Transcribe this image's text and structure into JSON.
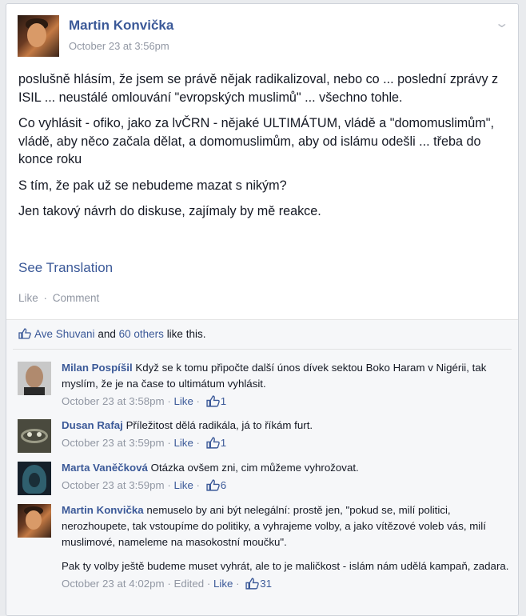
{
  "post": {
    "author": "Martin Konvička",
    "time": "October 23 at 3:56pm",
    "paragraphs": [
      "poslušně hlásím, že jsem se právě nějak radikalizoval, nebo co ... poslední zprávy z ISIL ... neustálé omlouvání \"evropských muslimů\" ... všechno tohle.",
      "Co vyhlásit - ofiko, jako za lvČRN - nějaké ULTIMÁTUM, vládě a \"domomuslimům\", vládě, aby něco začala dělat, a domomuslimům, aby od islámu odešli ... třeba do konce roku",
      "S tím, že pak už se nebudeme mazat s nikým?",
      "Jen takový návrh do diskuse, zajímaly by mě reakce."
    ],
    "see_translation": "See Translation",
    "like_label": "Like",
    "comment_label": "Comment",
    "separator": "·"
  },
  "likes": {
    "first_liker": "Ave Shuvani",
    "and_text": "and",
    "others": "60 others",
    "suffix": "like this."
  },
  "comments": [
    {
      "author": "Milan Pospíšil",
      "text": "Když se k tomu připočte další únos dívek sektou Boko Haram v Nigérii, tak myslím, že je na čase to ultimátum vyhlásit.",
      "time": "October 23 at 3:58pm",
      "like": "Like",
      "count": "1"
    },
    {
      "author": "Dusan Rafaj",
      "text": "Příležitost dělá radikála, já to říkám furt.",
      "time": "October 23 at 3:59pm",
      "like": "Like",
      "count": "1"
    },
    {
      "author": "Marta Vaněčková",
      "text": "Otázka ovšem zni, cim můžeme vyhrožovat.",
      "time": "October 23 at 3:59pm",
      "like": "Like",
      "count": "6"
    },
    {
      "author": "Martin Konvička",
      "text": "nemuselo by ani být nelegální: prostě jen, \"pokud se, milí politici, nerozhoupete, tak vstoupíme do politiky, a vyhrajeme volby, a jako vítězové voleb vás, milí muslimové, nameleme na masokostní moučku\".",
      "text2": "Pak ty volby ještě budeme muset vyhrát, ale to je maličkost - islám nám udělá kampaň, zadara.",
      "time": "October 23 at 4:02pm",
      "edited": "Edited",
      "like": "Like",
      "count": "31"
    }
  ],
  "colors": {
    "link": "#3b5998",
    "meta": "#9197a3",
    "background": "#e9ebee"
  }
}
